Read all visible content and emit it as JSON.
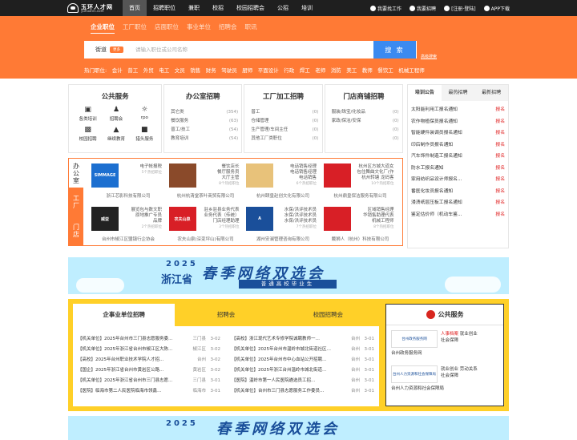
{
  "top": {
    "logo_cn": "玉环人才网",
    "logo_en": "yuhuanrc.com",
    "nav": [
      "首页",
      "招聘职位",
      "兼职",
      "校招",
      "校园招聘会",
      "公招",
      "培训"
    ],
    "user": [
      "我要找工作",
      "我要招聘",
      "[注册·登陆]",
      "APP下载"
    ]
  },
  "search": {
    "tabs": [
      "企业职位",
      "工厂职位",
      "店面职位",
      "事业单位",
      "招聘会",
      "职讯"
    ],
    "city": "街道",
    "city_tag": "更多",
    "placeholder": "请输入职位或公司名称",
    "button": "搜 索",
    "advanced": "高级搜索",
    "hot": [
      "热门职位:",
      "会计",
      "普工",
      "外贸",
      "电工",
      "文员",
      "销售",
      "财务",
      "驾驶员",
      "厨师",
      "平面设计",
      "行政",
      "焊工",
      "老师",
      "消防",
      "美工",
      "教师",
      "餐饮工",
      "机械工程师"
    ]
  },
  "public": {
    "title": "公共服务",
    "items": [
      "各类培训",
      "招聘会",
      "rpo",
      "校园招聘",
      "继续教育",
      "猎头服务"
    ],
    "icons": [
      "book-icon",
      "people-icon",
      "users-icon",
      "cap-icon",
      "edu-icon",
      "headhunt-icon"
    ]
  },
  "lists": [
    {
      "title": "办公室招聘",
      "rows": [
        [
          "其它类",
          "(354)"
        ],
        [
          "餐饮服务",
          "(63)"
        ],
        [
          "普工/技工",
          "(54)"
        ],
        [
          "教育培训",
          "(54)"
        ]
      ]
    },
    {
      "title": "工厂加工招聘",
      "rows": [
        [
          "普工",
          "(0)"
        ],
        [
          "仓储管理",
          "(0)"
        ],
        [
          "生产管理/车间主任",
          "(0)"
        ],
        [
          "其他工厂类职位",
          "(0)"
        ]
      ]
    },
    {
      "title": "门店商铺招聘",
      "rows": [
        [
          "服装/珠宝/化妆品",
          "(0)"
        ],
        [
          "家政/保洁/安保",
          "(0)"
        ],
        [
          "",
          "(0)"
        ],
        [
          "",
          "(0)"
        ]
      ]
    }
  ],
  "ads": {
    "tabs": [
      "办公室",
      "工厂",
      "门店"
    ],
    "items": [
      {
        "logo": "SIMMAGE",
        "color": "#1c6fd0",
        "lines": [
          "电子帐报税",
          "5个热招职位"
        ],
        "co": "浙江芯影科技有限公司"
      },
      {
        "logo": "",
        "color": "#8a4a2a",
        "lines": [
          "餐饮店长",
          "餐厅服务员",
          "大厅主管",
          "8个热招职位"
        ],
        "co": "杭州杭清堂茶叶商贸有限公司"
      },
      {
        "logo": "",
        "color": "#e8c27a",
        "lines": [
          "电话销售经理",
          "电话销售经理",
          "电话销售",
          "6个热招职位"
        ],
        "co": "杭州颐皇赵创文化有限公司"
      },
      {
        "logo": "",
        "color": "#d81f26",
        "lines": [
          "杭州区方城大道女",
          "包住舞曲文化厂(作",
          "杭州转塘 龙码客",
          "10个热招职位"
        ],
        "co": "杭州鼎皇保洁服务有限公司"
      },
      {
        "logo": "威亚",
        "color": "#222222",
        "lines": [
          "展览包与数文职",
          "原地推广专员",
          "品牌",
          "2个热招职位"
        ],
        "co": "台州市椒江区盟镇行企协会"
      },
      {
        "logo": "农夫山泉",
        "color": "#d81f26",
        "lines": [
          "驻乡驻县业务代表",
          "业务代表（传统）",
          "门店经理助理",
          "3个热招职位"
        ],
        "co": "农夫山泉(深变坪山)有限公司"
      },
      {
        "logo": "A",
        "color": "#1a4f9a",
        "lines": [
          "水保/洪评技术员",
          "水保/洪评技术员",
          "水保/洪评技术员",
          "7个热招职位"
        ],
        "co": "湖州安澜管理咨询有限公司"
      },
      {
        "logo": "",
        "color": "#d81f26",
        "lines": [
          "区域销售经理",
          "华销售助理代表",
          "机械工程师",
          "8个热招职位"
        ],
        "co": "戴狮人（杭州）科技有限公司"
      }
    ]
  },
  "news": {
    "tabs": [
      "培训公告",
      "最热招聘",
      "最新招聘"
    ],
    "rows": [
      [
        "太阳能利用工报名通知",
        "报名"
      ],
      [
        "农作物植保员报名通知",
        "报名"
      ],
      [
        "智能硬件装调员报名通知",
        "报名"
      ],
      [
        "印后制作员报名通知",
        "报名"
      ],
      [
        "汽车饰件制造工报名通知",
        "报名"
      ],
      [
        "防水工报名通知",
        "报名"
      ],
      [
        "家用纺织品设计师报名...",
        "报名"
      ],
      [
        "番医化妆员报名通知",
        "报名"
      ],
      [
        "浸渍纸层压板工报名通知",
        "报名"
      ],
      [
        "鉴定估价师（机动车鉴...",
        "报名"
      ]
    ]
  },
  "banner": {
    "year": "2025",
    "province": "浙江省",
    "main": "春季网络双选会",
    "sub": "普通高校毕业生"
  },
  "jobs": {
    "tabs": [
      "企事业单位招聘",
      "招聘会",
      "校园招聘会"
    ],
    "left": [
      [
        "【机关单位】2025年台州市三门县志愿服务委…",
        "三门县",
        "3-02"
      ],
      [
        "【机关单位】2025年浙江省台州市椒江区大陈…",
        "椒江区",
        "3-02"
      ],
      [
        "【高校】2025年台州职业技术学院人才招…",
        "台州",
        "3-02"
      ],
      [
        "【国企】2025年浙江省台州市黄岩区公路…",
        "黄岩区",
        "3-02"
      ],
      [
        "【机关单位】2025年浙江省台州市三门县志愿…",
        "三门县",
        "3-01"
      ],
      [
        "【医院】临海市第二人民医院临海市领鑫…",
        "临海市",
        "3-01"
      ]
    ],
    "right": [
      [
        "【高校】浙江现代艺术专修学院诚聘教师一…",
        "台州",
        "3-01"
      ],
      [
        "【机关单位】2025年台州市温岭市城北街道社区…",
        "台州",
        "3-01"
      ],
      [
        "【机关单位】2025年台州市中心血站公开招聘…",
        "台州",
        "3-01"
      ],
      [
        "【机关单位】2025年浙江台州温岭市城北街道…",
        "台州",
        "3-01"
      ],
      [
        "【医院】温岭市第一人民医院遴选员工招…",
        "台州",
        "3-01"
      ],
      [
        "【机关单位】台州市三门县志愿服务工作委员…",
        "台州",
        "3-01"
      ]
    ]
  },
  "yservice": {
    "title": "公共服务",
    "items": [
      {
        "logo": "台州政务服务网",
        "links": [
          "人事档案",
          "就业创业",
          "社会保障"
        ],
        "name": "台州政务服务网"
      },
      {
        "logo": "台州人力资源和社会保障局",
        "links": [
          "就业创业",
          "劳动关系",
          "社会保障"
        ],
        "name": "台州人力资源和社会保障局"
      }
    ]
  },
  "banner2": {
    "year": "2025",
    "main": "春季网络双选会"
  }
}
